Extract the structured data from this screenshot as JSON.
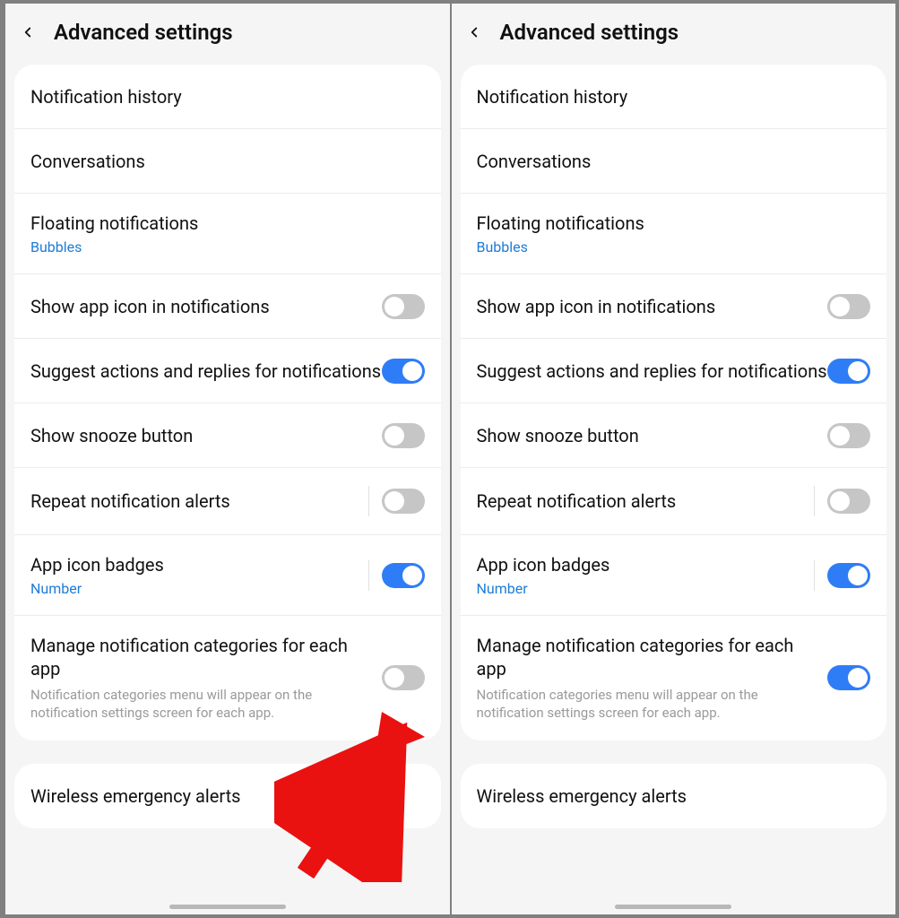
{
  "header": {
    "title": "Advanced settings"
  },
  "rows": {
    "history": {
      "title": "Notification history"
    },
    "conv": {
      "title": "Conversations"
    },
    "floating": {
      "title": "Floating notifications",
      "sub": "Bubbles"
    },
    "appicon": {
      "title": "Show app icon in notifications"
    },
    "suggest": {
      "title": "Suggest actions and replies for notifications"
    },
    "snooze": {
      "title": "Show snooze button"
    },
    "repeat": {
      "title": "Repeat notification alerts"
    },
    "badges": {
      "title": "App icon badges",
      "sub": "Number"
    },
    "manage": {
      "title": "Manage notification categories for each app",
      "desc": "Notification categories menu will appear on the notification settings screen for each app."
    },
    "wireless": {
      "title": "Wireless emergency alerts"
    }
  },
  "toggles": {
    "left": {
      "appicon": false,
      "suggest": true,
      "snooze": false,
      "repeat": false,
      "badges": true,
      "manage": false
    },
    "right": {
      "appicon": false,
      "suggest": true,
      "snooze": false,
      "repeat": false,
      "badges": true,
      "manage": true
    }
  }
}
